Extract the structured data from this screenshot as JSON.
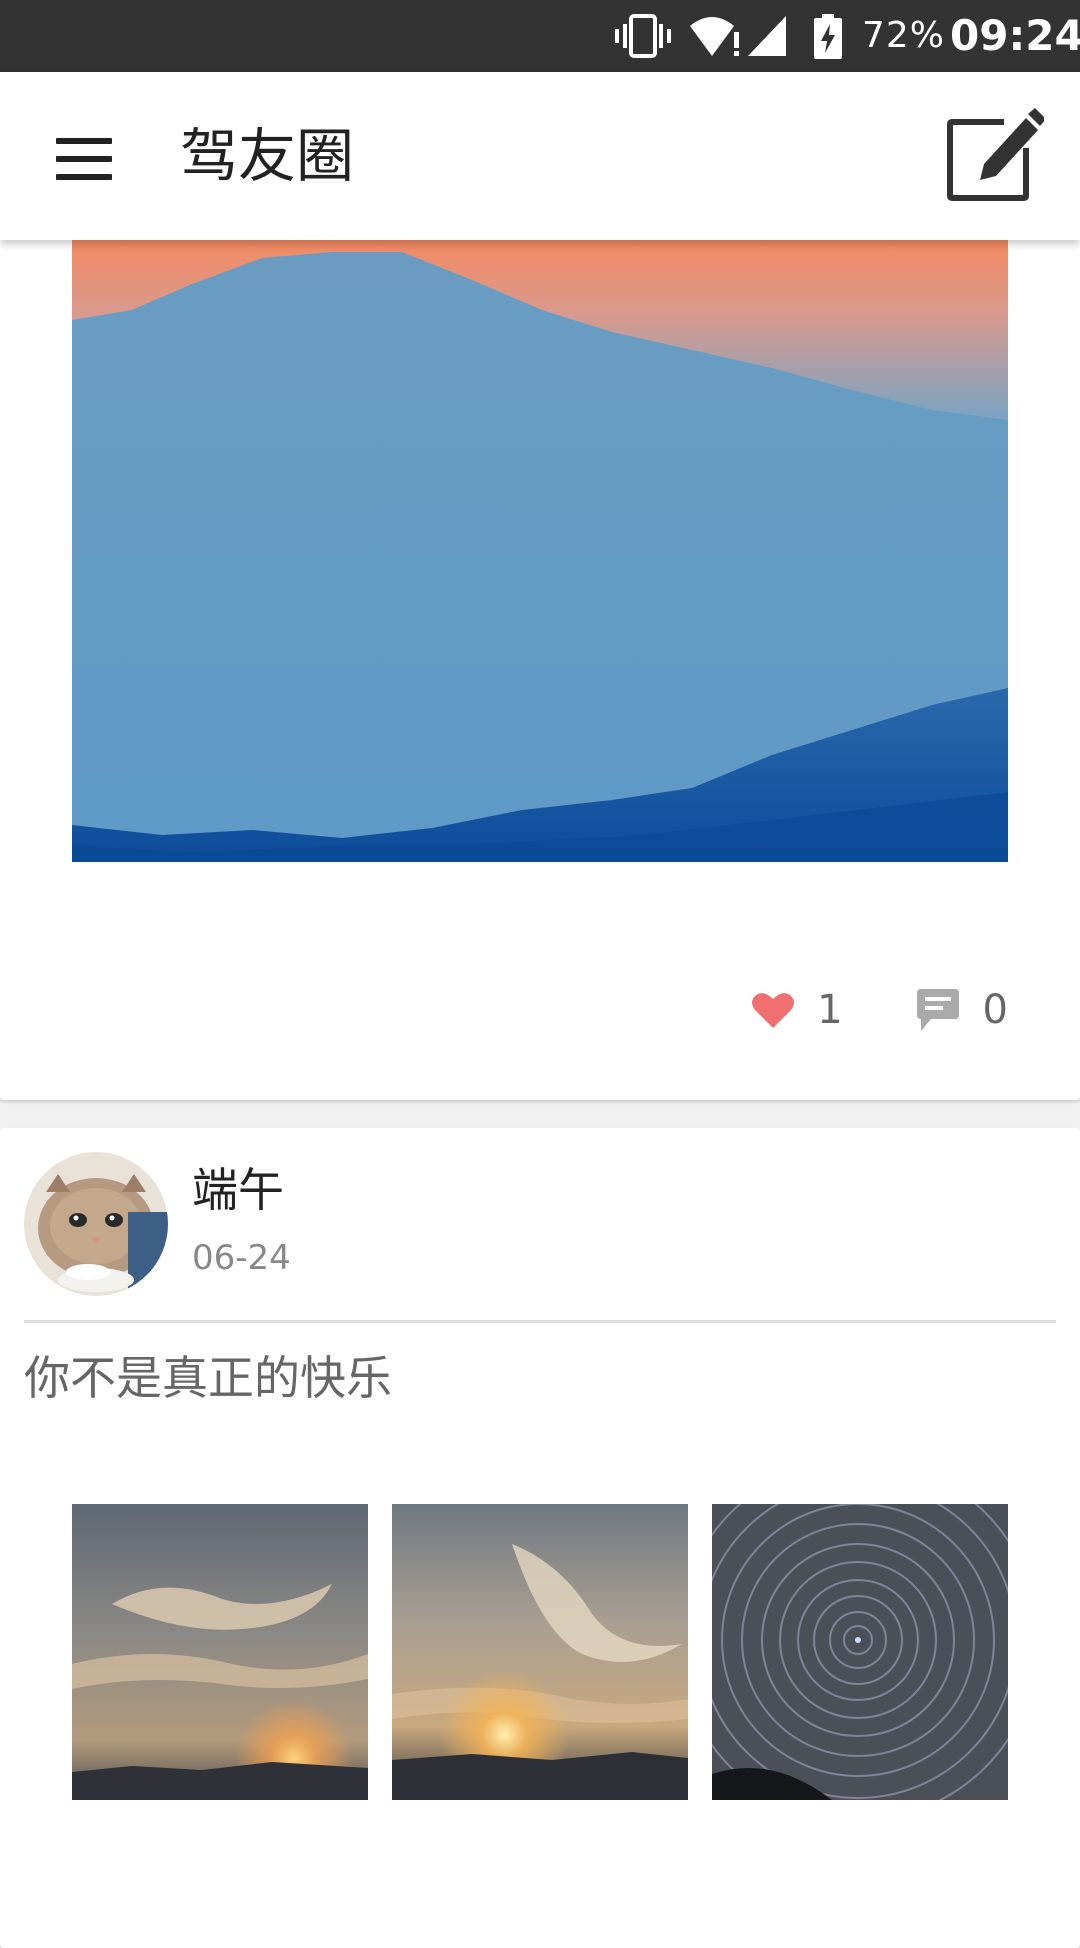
{
  "status_bar": {
    "battery_percent": "72%",
    "time": "09:24",
    "icons": [
      "vibrate-icon",
      "wifi-alert-icon",
      "cell-signal-icon",
      "battery-charging-icon"
    ]
  },
  "app_bar": {
    "title": "驾友圈",
    "menu_icon": "hamburger-menu-icon",
    "compose_icon": "edit-icon"
  },
  "feed": {
    "post_1": {
      "image": "mountain-sunset-photo",
      "likes": "1",
      "comments": "0"
    },
    "post_2": {
      "author": "端午",
      "avatar": "cat-avatar",
      "date": "06-24",
      "text": "你不是真正的快乐",
      "images": [
        "sunset-clouds-photo",
        "sunset-sky-photo",
        "star-trail-photo"
      ]
    }
  },
  "colors": {
    "status_bar_bg": "#333333",
    "heart": "#f07070",
    "icon_gray": "#aaaaaa",
    "text_dark": "#222222",
    "text_gray": "#666666"
  }
}
